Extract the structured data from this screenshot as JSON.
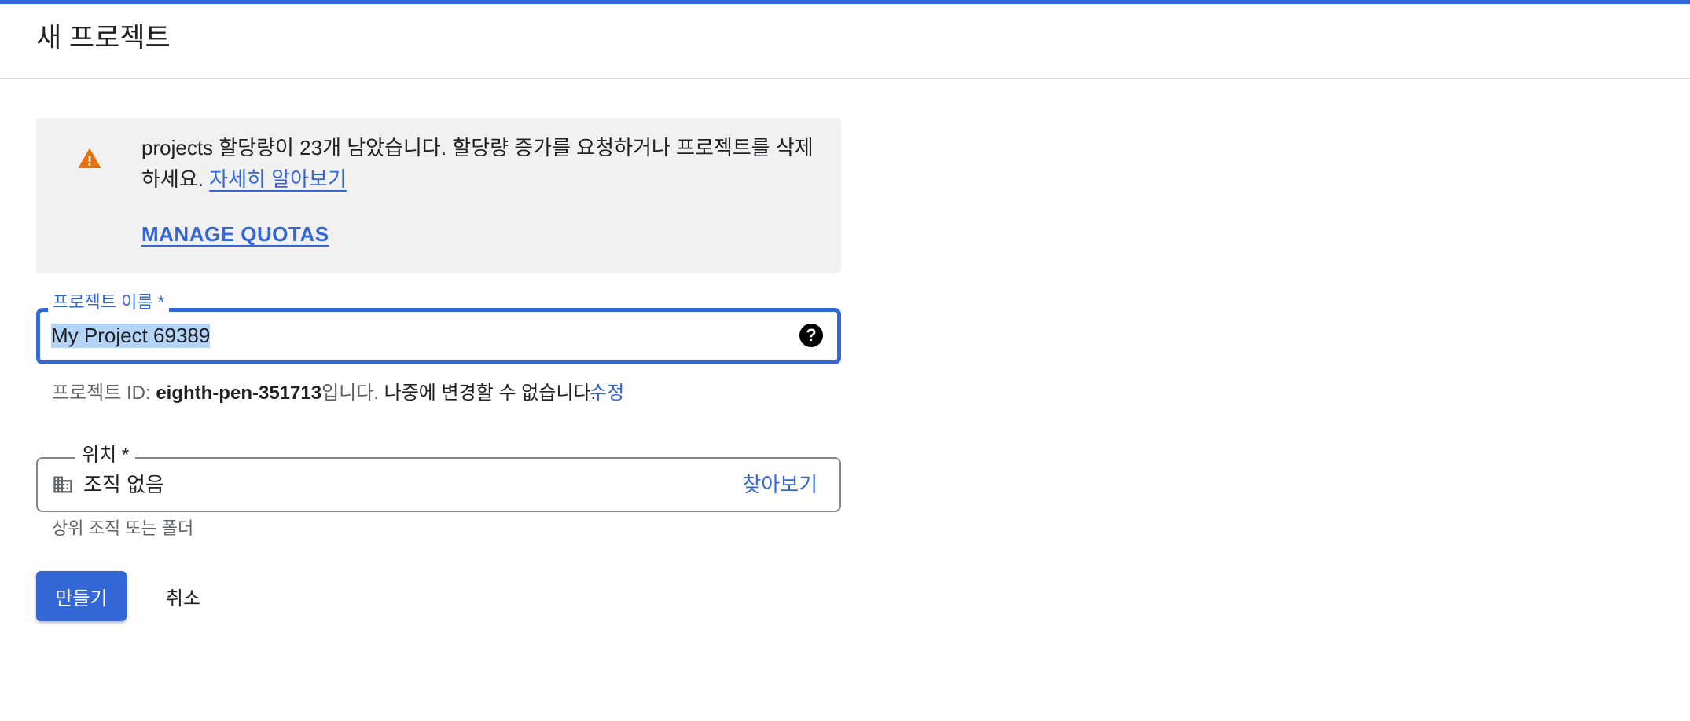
{
  "header": {
    "title": "새 프로젝트"
  },
  "banner": {
    "message": "projects 할당량이 23개 남았습니다. 할당량 증가를 요청하거나 프로젝트를 삭제하세요. ",
    "learn_more_label": "자세히 알아보기",
    "manage_quotas_label": "MANAGE QUOTAS",
    "icon": "warning-icon",
    "icon_color": "#e8710a"
  },
  "project_name": {
    "label": "프로젝트 이름 *",
    "value": "My Project 69389",
    "help_icon": "help-icon"
  },
  "project_id": {
    "prefix": "프로젝트 ID: ",
    "id": "eighth-pen-351713",
    "suffix": "입니다. ",
    "note": "나중에 변경할 수 없습니다.",
    "edit_label": "수정"
  },
  "location": {
    "label": "위치 *",
    "icon": "building-icon",
    "value": "조직 없음",
    "browse_label": "찾아보기",
    "hint": "상위 조직 또는 폴더"
  },
  "actions": {
    "create_label": "만들기",
    "cancel_label": "취소"
  },
  "colors": {
    "accent": "#3367d6",
    "warning": "#e8710a",
    "banner_bg": "#f1f1f1"
  }
}
